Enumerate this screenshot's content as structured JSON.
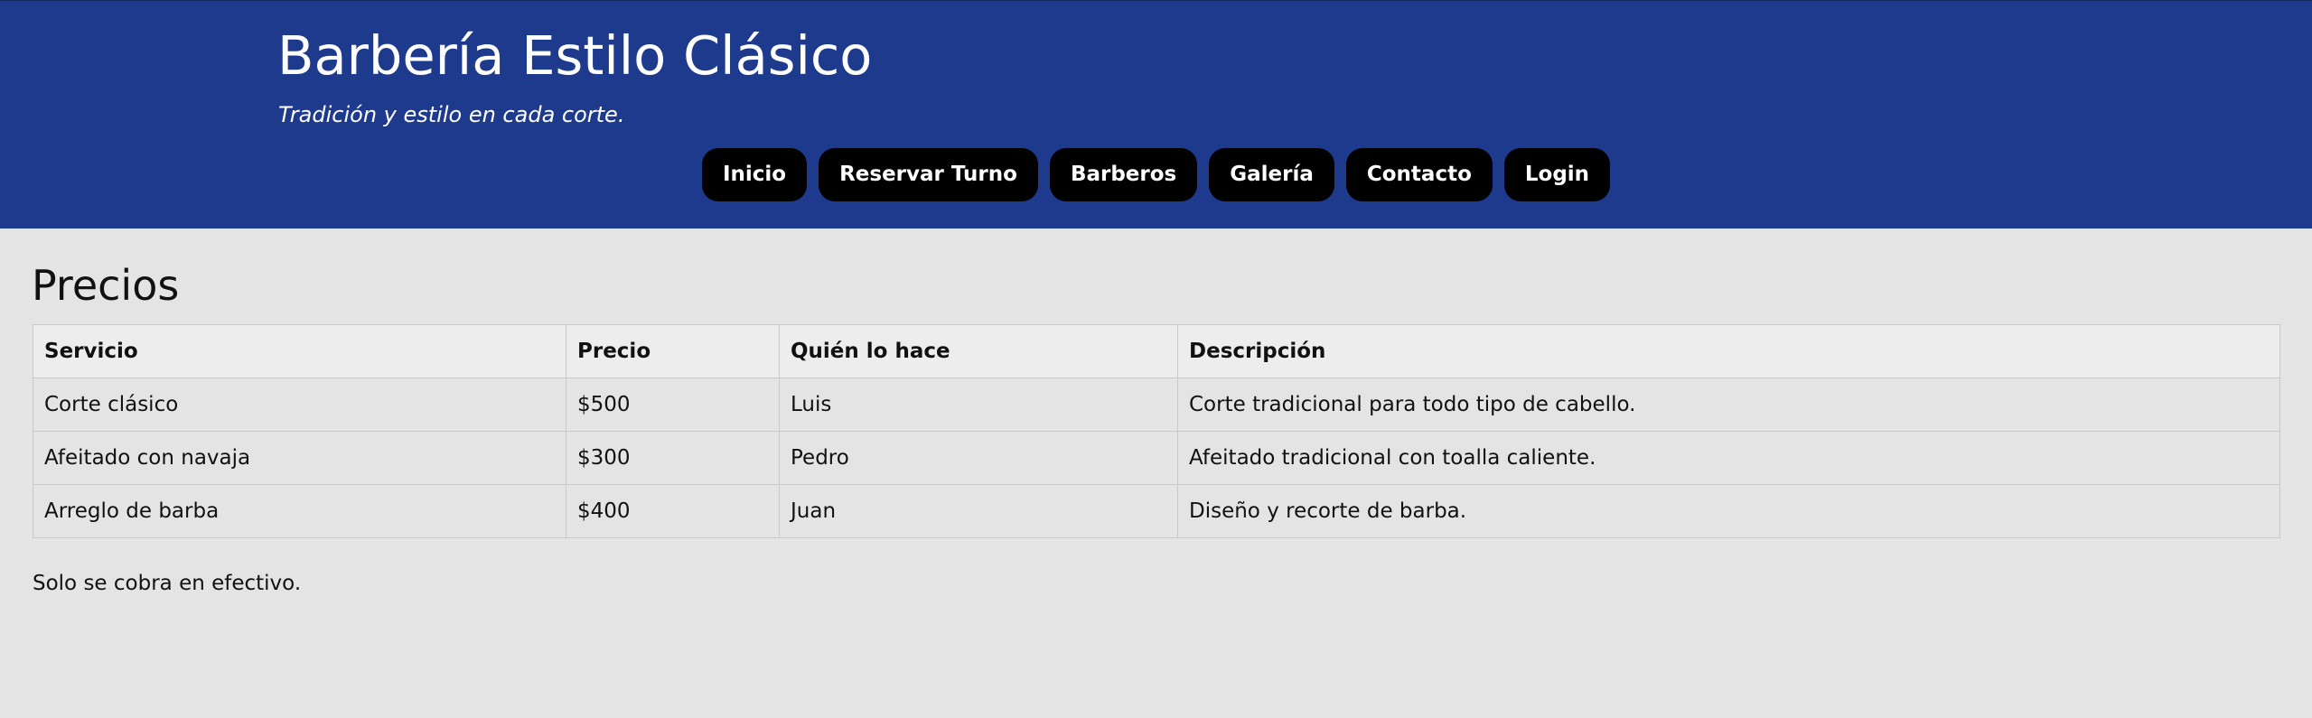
{
  "header": {
    "title": "Barbería Estilo Clásico",
    "tagline": "Tradición y estilo en cada corte.",
    "background_color": "#1e3a8c"
  },
  "nav": {
    "items": [
      {
        "label": "Inicio"
      },
      {
        "label": "Reservar Turno"
      },
      {
        "label": "Barberos"
      },
      {
        "label": "Galería"
      },
      {
        "label": "Contacto"
      },
      {
        "label": "Login"
      }
    ],
    "button_color": "#000000"
  },
  "main": {
    "heading": "Precios",
    "table": {
      "headers": [
        "Servicio",
        "Precio",
        "Quién lo hace",
        "Descripción"
      ],
      "rows": [
        [
          "Corte clásico",
          "$500",
          "Luis",
          "Corte tradicional para todo tipo de cabello."
        ],
        [
          "Afeitado con navaja",
          "$300",
          "Pedro",
          "Afeitado tradicional con toalla caliente."
        ],
        [
          "Arreglo de barba",
          "$400",
          "Juan",
          "Diseño y recorte de barba."
        ]
      ]
    },
    "note": "Solo se cobra en efectivo."
  }
}
